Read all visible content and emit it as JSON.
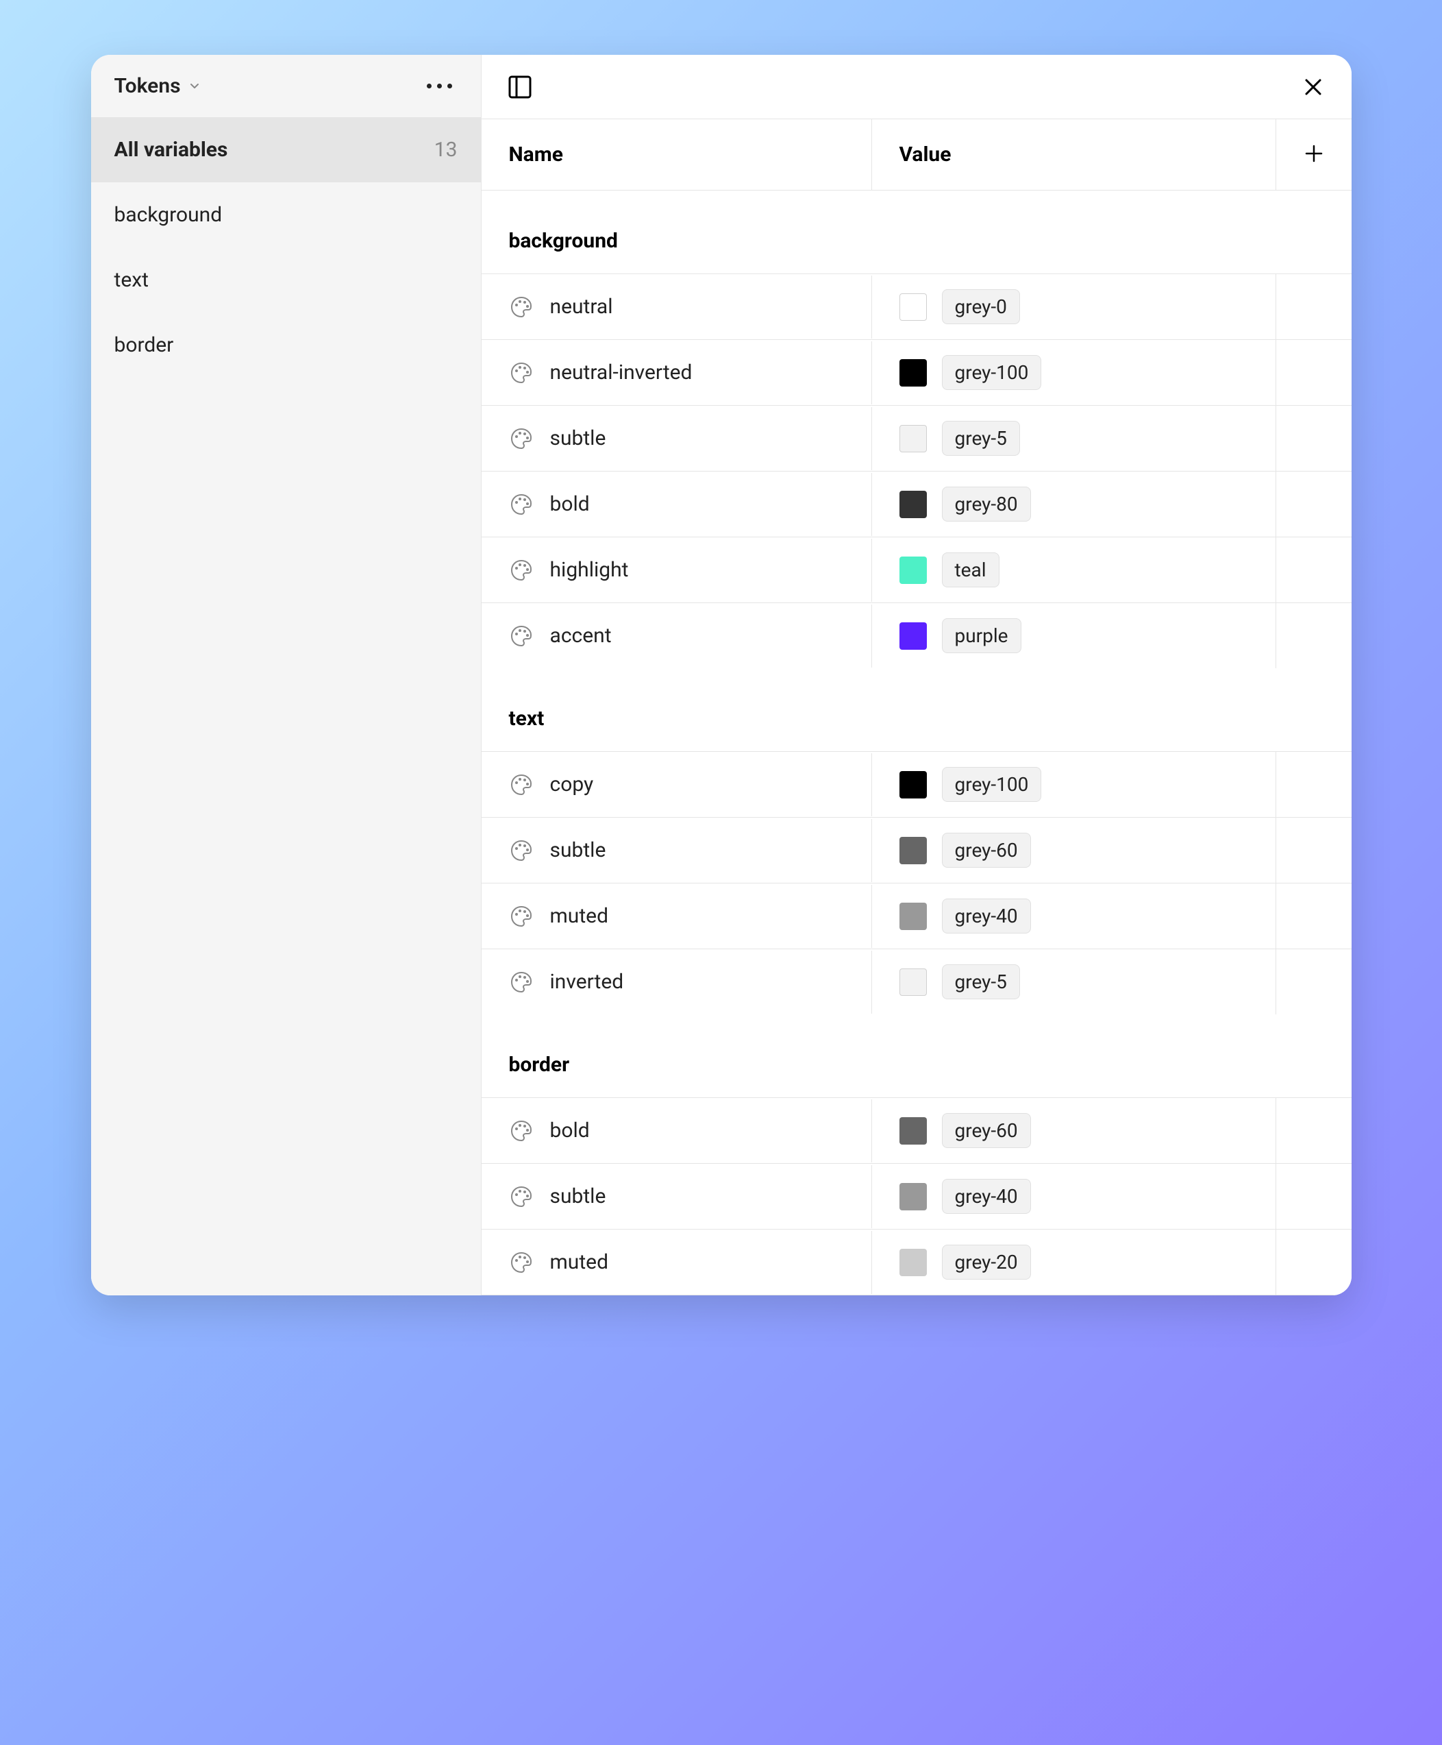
{
  "sidebar": {
    "title": "Tokens",
    "all_label": "All variables",
    "all_count": "13",
    "categories": [
      {
        "label": "background"
      },
      {
        "label": "text"
      },
      {
        "label": "border"
      }
    ]
  },
  "columns": {
    "name": "Name",
    "value": "Value"
  },
  "groups": [
    {
      "title": "background",
      "rows": [
        {
          "name": "neutral",
          "value_label": "grey-0",
          "swatch": "#ffffff",
          "bordered": true
        },
        {
          "name": "neutral-inverted",
          "value_label": "grey-100",
          "swatch": "#000000",
          "bordered": false
        },
        {
          "name": "subtle",
          "value_label": "grey-5",
          "swatch": "#f2f2f2",
          "bordered": true
        },
        {
          "name": "bold",
          "value_label": "grey-80",
          "swatch": "#333333",
          "bordered": false
        },
        {
          "name": "highlight",
          "value_label": "teal",
          "swatch": "#4ef0c6",
          "bordered": false
        },
        {
          "name": "accent",
          "value_label": "purple",
          "swatch": "#5b21ff",
          "bordered": false
        }
      ]
    },
    {
      "title": "text",
      "rows": [
        {
          "name": "copy",
          "value_label": "grey-100",
          "swatch": "#000000",
          "bordered": false
        },
        {
          "name": "subtle",
          "value_label": "grey-60",
          "swatch": "#666666",
          "bordered": false
        },
        {
          "name": "muted",
          "value_label": "grey-40",
          "swatch": "#999999",
          "bordered": false
        },
        {
          "name": "inverted",
          "value_label": "grey-5",
          "swatch": "#f2f2f2",
          "bordered": true
        }
      ]
    },
    {
      "title": "border",
      "rows": [
        {
          "name": "bold",
          "value_label": "grey-60",
          "swatch": "#666666",
          "bordered": false
        },
        {
          "name": "subtle",
          "value_label": "grey-40",
          "swatch": "#999999",
          "bordered": false
        },
        {
          "name": "muted",
          "value_label": "grey-20",
          "swatch": "#cccccc",
          "bordered": false
        }
      ]
    }
  ]
}
